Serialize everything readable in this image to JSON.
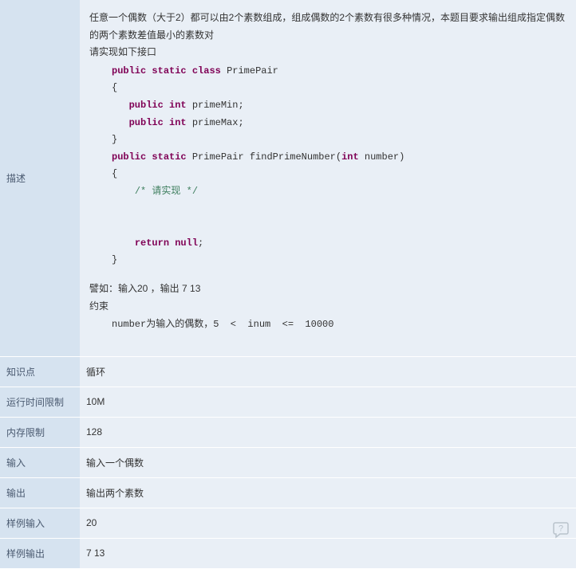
{
  "labels": {
    "description": "描述",
    "knowledge": "知识点",
    "runtime": "运行时间限制",
    "memory": "内存限制",
    "input": "输入",
    "output": "输出",
    "sample_input": "样例输入",
    "sample_output": "样例输出"
  },
  "desc": {
    "line1": "任意一个偶数（大于2）都可以由2个素数组成，组成偶数的2个素数有很多种情况，本题目要求输出组成指定偶数的两个素数差值最小的素数对",
    "line2": "请实现如下接口",
    "example_label": "譬如：输入20 ，输出 7  13",
    "constraint_label": "约束",
    "constraint_text": "number为输入的偶数，5  <  inum  <=  10000"
  },
  "code": {
    "kw_public": "public",
    "kw_static": "static",
    "kw_class": "class",
    "kw_int": "int",
    "kw_return": "return",
    "kw_null": "null",
    "cls_primepair": "PrimePair",
    "fld_primeMin": "primeMin;",
    "fld_primeMax": "primeMax;",
    "fn_name": "findPrimeNumber(",
    "fn_param": " number)",
    "comment": "/* 请实现 */",
    "brace_open": "{",
    "brace_close": "}",
    "semicolon": ";"
  },
  "values": {
    "knowledge": "循环",
    "runtime": "10M",
    "memory": "128",
    "input": "输入一个偶数",
    "output": "输出两个素数",
    "sample_input": "20",
    "sample_output": "7 13"
  },
  "icons": {
    "help": "help-bubble-icon"
  }
}
